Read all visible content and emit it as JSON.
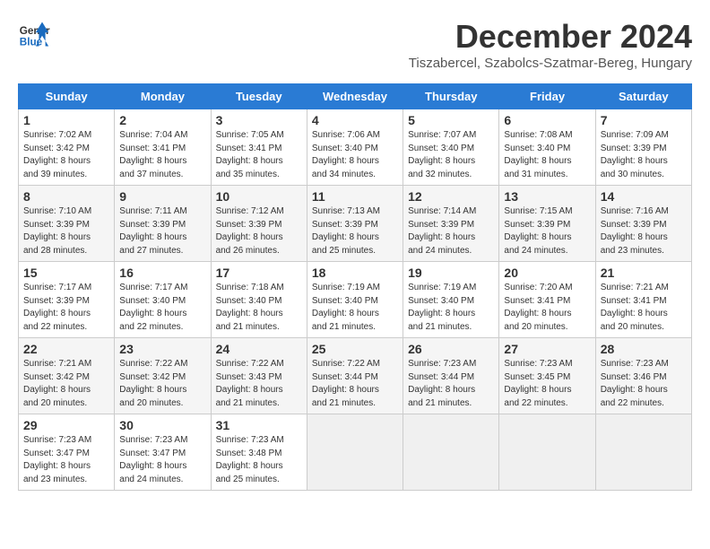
{
  "header": {
    "logo_line1": "General",
    "logo_line2": "Blue",
    "month": "December 2024",
    "location": "Tiszabercel, Szabolcs-Szatmar-Bereg, Hungary"
  },
  "weekdays": [
    "Sunday",
    "Monday",
    "Tuesday",
    "Wednesday",
    "Thursday",
    "Friday",
    "Saturday"
  ],
  "weeks": [
    [
      {
        "day": "1",
        "info": "Sunrise: 7:02 AM\nSunset: 3:42 PM\nDaylight: 8 hours\nand 39 minutes."
      },
      {
        "day": "2",
        "info": "Sunrise: 7:04 AM\nSunset: 3:41 PM\nDaylight: 8 hours\nand 37 minutes."
      },
      {
        "day": "3",
        "info": "Sunrise: 7:05 AM\nSunset: 3:41 PM\nDaylight: 8 hours\nand 35 minutes."
      },
      {
        "day": "4",
        "info": "Sunrise: 7:06 AM\nSunset: 3:40 PM\nDaylight: 8 hours\nand 34 minutes."
      },
      {
        "day": "5",
        "info": "Sunrise: 7:07 AM\nSunset: 3:40 PM\nDaylight: 8 hours\nand 32 minutes."
      },
      {
        "day": "6",
        "info": "Sunrise: 7:08 AM\nSunset: 3:40 PM\nDaylight: 8 hours\nand 31 minutes."
      },
      {
        "day": "7",
        "info": "Sunrise: 7:09 AM\nSunset: 3:39 PM\nDaylight: 8 hours\nand 30 minutes."
      }
    ],
    [
      {
        "day": "8",
        "info": "Sunrise: 7:10 AM\nSunset: 3:39 PM\nDaylight: 8 hours\nand 28 minutes."
      },
      {
        "day": "9",
        "info": "Sunrise: 7:11 AM\nSunset: 3:39 PM\nDaylight: 8 hours\nand 27 minutes."
      },
      {
        "day": "10",
        "info": "Sunrise: 7:12 AM\nSunset: 3:39 PM\nDaylight: 8 hours\nand 26 minutes."
      },
      {
        "day": "11",
        "info": "Sunrise: 7:13 AM\nSunset: 3:39 PM\nDaylight: 8 hours\nand 25 minutes."
      },
      {
        "day": "12",
        "info": "Sunrise: 7:14 AM\nSunset: 3:39 PM\nDaylight: 8 hours\nand 24 minutes."
      },
      {
        "day": "13",
        "info": "Sunrise: 7:15 AM\nSunset: 3:39 PM\nDaylight: 8 hours\nand 24 minutes."
      },
      {
        "day": "14",
        "info": "Sunrise: 7:16 AM\nSunset: 3:39 PM\nDaylight: 8 hours\nand 23 minutes."
      }
    ],
    [
      {
        "day": "15",
        "info": "Sunrise: 7:17 AM\nSunset: 3:39 PM\nDaylight: 8 hours\nand 22 minutes."
      },
      {
        "day": "16",
        "info": "Sunrise: 7:17 AM\nSunset: 3:40 PM\nDaylight: 8 hours\nand 22 minutes."
      },
      {
        "day": "17",
        "info": "Sunrise: 7:18 AM\nSunset: 3:40 PM\nDaylight: 8 hours\nand 21 minutes."
      },
      {
        "day": "18",
        "info": "Sunrise: 7:19 AM\nSunset: 3:40 PM\nDaylight: 8 hours\nand 21 minutes."
      },
      {
        "day": "19",
        "info": "Sunrise: 7:19 AM\nSunset: 3:40 PM\nDaylight: 8 hours\nand 21 minutes."
      },
      {
        "day": "20",
        "info": "Sunrise: 7:20 AM\nSunset: 3:41 PM\nDaylight: 8 hours\nand 20 minutes."
      },
      {
        "day": "21",
        "info": "Sunrise: 7:21 AM\nSunset: 3:41 PM\nDaylight: 8 hours\nand 20 minutes."
      }
    ],
    [
      {
        "day": "22",
        "info": "Sunrise: 7:21 AM\nSunset: 3:42 PM\nDaylight: 8 hours\nand 20 minutes."
      },
      {
        "day": "23",
        "info": "Sunrise: 7:22 AM\nSunset: 3:42 PM\nDaylight: 8 hours\nand 20 minutes."
      },
      {
        "day": "24",
        "info": "Sunrise: 7:22 AM\nSunset: 3:43 PM\nDaylight: 8 hours\nand 21 minutes."
      },
      {
        "day": "25",
        "info": "Sunrise: 7:22 AM\nSunset: 3:44 PM\nDaylight: 8 hours\nand 21 minutes."
      },
      {
        "day": "26",
        "info": "Sunrise: 7:23 AM\nSunset: 3:44 PM\nDaylight: 8 hours\nand 21 minutes."
      },
      {
        "day": "27",
        "info": "Sunrise: 7:23 AM\nSunset: 3:45 PM\nDaylight: 8 hours\nand 22 minutes."
      },
      {
        "day": "28",
        "info": "Sunrise: 7:23 AM\nSunset: 3:46 PM\nDaylight: 8 hours\nand 22 minutes."
      }
    ],
    [
      {
        "day": "29",
        "info": "Sunrise: 7:23 AM\nSunset: 3:47 PM\nDaylight: 8 hours\nand 23 minutes."
      },
      {
        "day": "30",
        "info": "Sunrise: 7:23 AM\nSunset: 3:47 PM\nDaylight: 8 hours\nand 24 minutes."
      },
      {
        "day": "31",
        "info": "Sunrise: 7:23 AM\nSunset: 3:48 PM\nDaylight: 8 hours\nand 25 minutes."
      },
      null,
      null,
      null,
      null
    ]
  ]
}
